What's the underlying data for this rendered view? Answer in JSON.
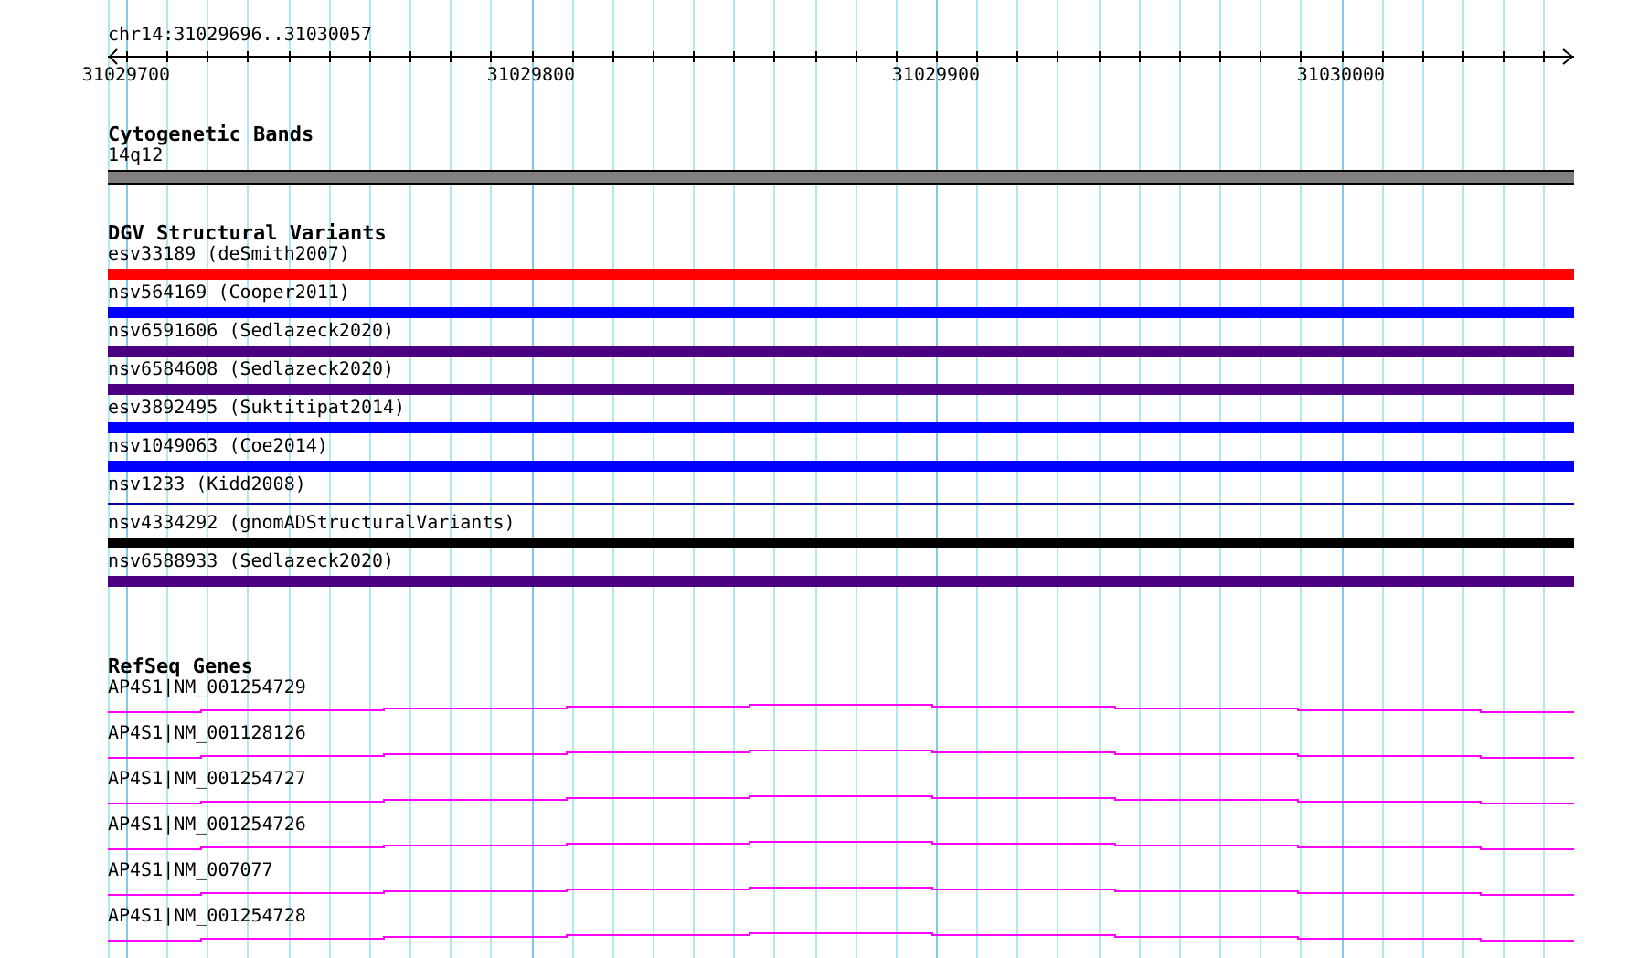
{
  "ruler": {
    "location": "chr14:31029696..31030057",
    "ticks": [
      "31029700",
      "31029800",
      "31029900",
      "31030000"
    ]
  },
  "cytogenetic_bands": {
    "title": "Cytogenetic Bands",
    "features": [
      {
        "label": "14q12",
        "color": "#808080"
      }
    ]
  },
  "dgv_structural_variants": {
    "title": "DGV Structural Variants",
    "features": [
      {
        "label": "esv33189 (deSmith2007)",
        "kind": "bar",
        "color": "#ff0000"
      },
      {
        "label": "nsv564169 (Cooper2011)",
        "kind": "bar",
        "color": "#0000ff"
      },
      {
        "label": "nsv6591606 (Sedlazeck2020)",
        "kind": "bar",
        "color": "#4b0082"
      },
      {
        "label": "nsv6584608 (Sedlazeck2020)",
        "kind": "bar",
        "color": "#4b0082"
      },
      {
        "label": "esv3892495 (Suktitipat2014)",
        "kind": "bar",
        "color": "#0000ff"
      },
      {
        "label": "nsv1049063 (Coe2014)",
        "kind": "bar",
        "color": "#0000ff"
      },
      {
        "label": "nsv1233 (Kidd2008)",
        "kind": "line",
        "color": "#0000a0"
      },
      {
        "label": "nsv4334292 (gnomADStructuralVariants)",
        "kind": "bar",
        "color": "#000000"
      },
      {
        "label": "nsv6588933 (Sedlazeck2020)",
        "kind": "bar",
        "color": "#4b0082"
      }
    ]
  },
  "refseq_genes": {
    "title": "RefSeq Genes",
    "features": [
      {
        "label": "AP4S1|NM_001254729"
      },
      {
        "label": "AP4S1|NM_001128126"
      },
      {
        "label": "AP4S1|NM_001254727"
      },
      {
        "label": "AP4S1|NM_001254726"
      },
      {
        "label": "AP4S1|NM_007077"
      },
      {
        "label": "AP4S1|NM_001254728"
      }
    ]
  }
}
